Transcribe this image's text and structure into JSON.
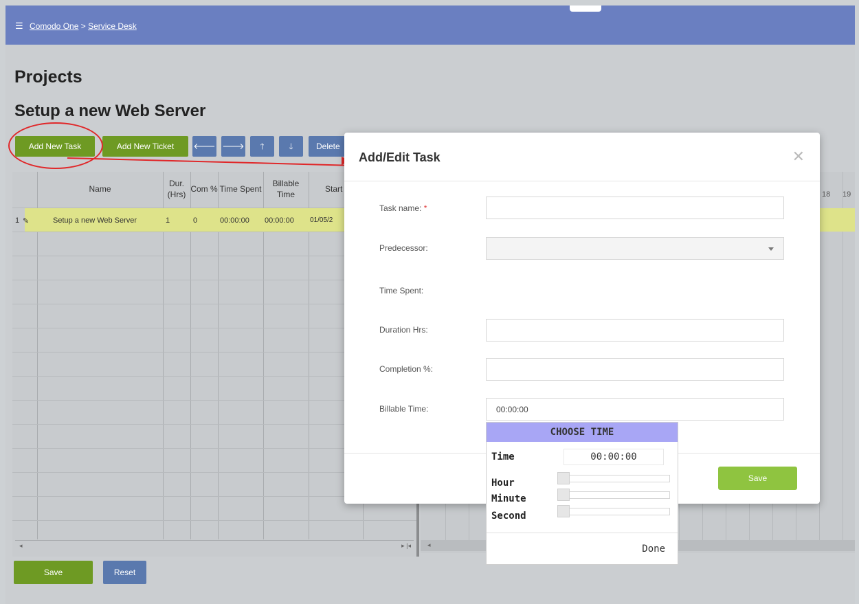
{
  "breadcrumb": {
    "menu_icon": "☰",
    "root": "Comodo One",
    "separator": ">",
    "current": "Service Desk"
  },
  "page": {
    "heading": "Projects",
    "project_title": "Setup a new Web Server"
  },
  "toolbar": {
    "add_task_label": "Add New Task",
    "add_ticket_label": "Add New Ticket",
    "arrow_left": "🡐",
    "arrow_right": "🡒",
    "arrow_up": "🡑",
    "arrow_down": "🡓",
    "delete_label": "Delete"
  },
  "grid": {
    "headers": [
      "Name",
      "Dur. (Hrs)",
      "Com %",
      "Time Spent",
      "Billable Time",
      "Start"
    ],
    "row": {
      "num": "1",
      "edit_icon": "✎",
      "name": "Setup a new Web Server",
      "duration": "1",
      "completion": "0",
      "time_spent": "00:00:00",
      "billable": "00:00:00",
      "start": "01/05/2"
    },
    "scroll_left": "◂",
    "scroll_right": "▸ |◂"
  },
  "gantt": {
    "day_numbers": [
      "18",
      "19"
    ]
  },
  "footer": {
    "save_label": "Save",
    "reset_label": "Reset"
  },
  "modal": {
    "title": "Add/Edit Task",
    "close_symbol": "✕",
    "fields": {
      "task_name_label": "Task name:",
      "required_mark": "*",
      "predecessor_label": "Predecessor:",
      "time_spent_label": "Time Spent:",
      "duration_label": "Duration Hrs:",
      "completion_label": "Completion %:",
      "billable_label": "Billable Time:",
      "billable_value": "00:00:00"
    },
    "save_label": "Save"
  },
  "time_picker": {
    "title": "CHOOSE TIME",
    "time_label": "Time",
    "time_value": "00:00:00",
    "hour_label": "Hour",
    "minute_label": "Minute",
    "second_label": "Second",
    "hour_value": 0,
    "minute_value": 0,
    "second_value": 0,
    "done_label": "Done"
  },
  "colors": {
    "header_bar": "#6a7fc1",
    "green_button": "#6e9a23",
    "blue_button": "#5a79ae",
    "highlight_row": "#dee38a",
    "annotation": "#e0282a",
    "picker_header": "#a8a6f5",
    "modal_save": "#8fc440"
  }
}
